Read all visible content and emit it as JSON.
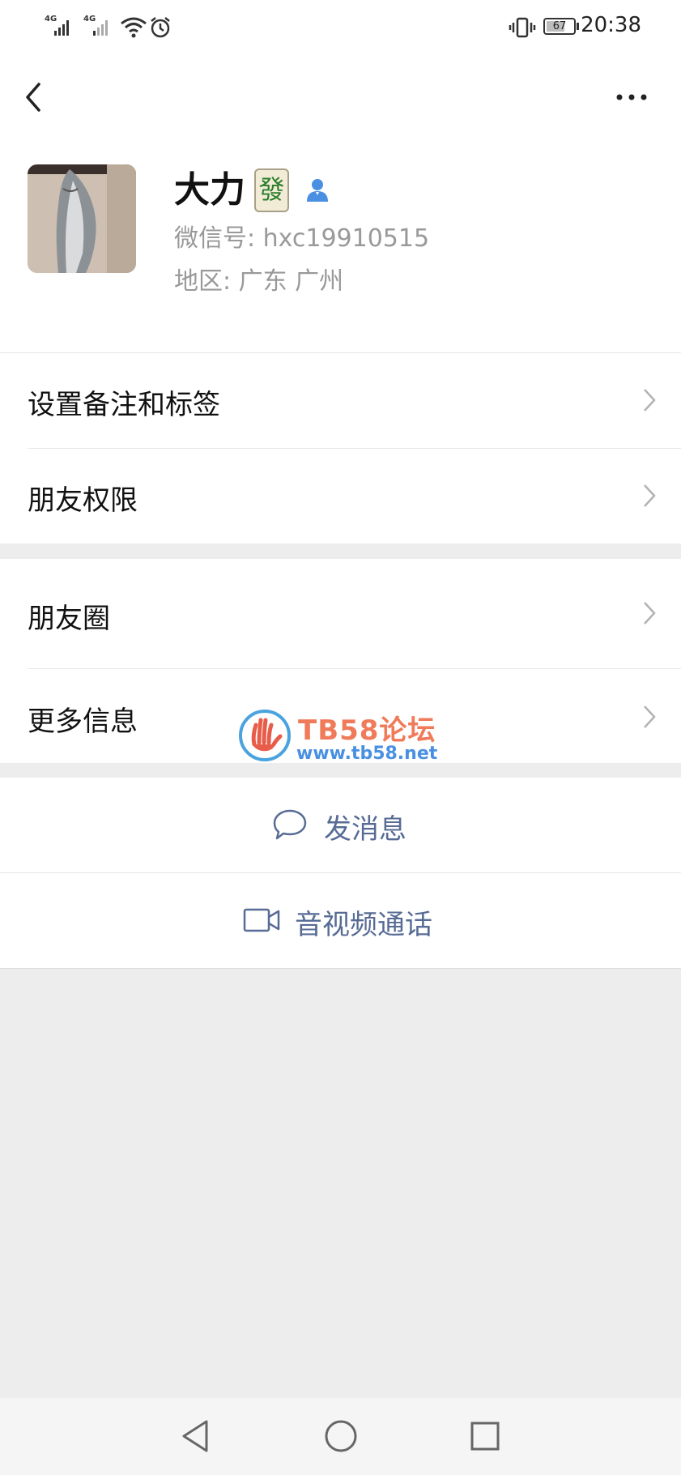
{
  "status_bar": {
    "signal1_label": "4G",
    "signal2_label": "4G",
    "battery": "67",
    "time": "20:38",
    "icons": [
      "signal-icon",
      "signal-icon",
      "wifi-icon",
      "alarm-icon",
      "vibrate-icon",
      "battery-icon"
    ]
  },
  "header": {
    "back_icon": "back-arrow-icon",
    "more_icon": "more-dots-icon"
  },
  "profile": {
    "name": "大力",
    "badge_char": "發",
    "wechat_id": "微信号:  hxc19910515",
    "region": "地区:  广东  广州"
  },
  "menu": {
    "set_remark": "设置备注和标签",
    "friend_permissions": "朋友权限",
    "moments": "朋友圈",
    "more_info": "更多信息"
  },
  "actions": {
    "send_message": "发消息",
    "video_call": "音视频通话"
  },
  "watermark": {
    "title": "TB58论坛",
    "url": "www.tb58.net"
  },
  "colors": {
    "link": "#576b95",
    "background": "#ededed",
    "watermark_orange": "#f07b5a",
    "watermark_blue": "#4a90e2"
  }
}
